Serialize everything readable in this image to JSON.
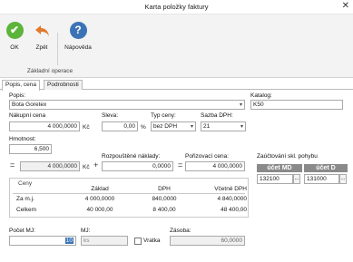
{
  "window": {
    "title": "Karta položky faktury",
    "close_glyph": "✕"
  },
  "ribbon": {
    "ok_label": "OK",
    "back_label": "Zpět",
    "help_label": "Nápověda",
    "group_label": "Základní operace",
    "ok_icon": "check-circle-icon",
    "back_icon": "undo-arrow-icon",
    "help_icon": "question-circle-icon"
  },
  "tabs": [
    {
      "label": "Popis, cena",
      "active": true
    },
    {
      "label": "Podrobnosti",
      "active": false
    }
  ],
  "form": {
    "popis_label": "Popis:",
    "popis_value": "Bota Goretex",
    "katalog_label": "Katalog:",
    "katalog_value": "K50",
    "nakupni_label": "Nákupní cena",
    "nakupni_value": "4 000,0000",
    "nakupni_unit": "Kč",
    "sleva_label": "Sleva:",
    "sleva_value": "0,00",
    "sleva_unit": "%",
    "typ_label": "Typ ceny:",
    "typ_value": "bez DPH",
    "sazba_label": "Sazba DPH:",
    "sazba_value": "21",
    "hmotnost_label": "Hmotnost:",
    "hmotnost_value": "6,500",
    "eq1": "=",
    "cena_value": "4 000,0000",
    "cena_unit": "Kč",
    "plus": "+",
    "rozp_label": "Rozpouštěné náklady:",
    "rozp_value": "0,0000",
    "eq2": "=",
    "poriz_label": "Pořizovací cena:",
    "poriz_value": "4 000,0000"
  },
  "prices": {
    "group_label": "Ceny",
    "columns": [
      "Základ",
      "DPH",
      "Včetně DPH"
    ],
    "rows": [
      {
        "label": "Za m.j.",
        "zaklad": "4 000,0000",
        "dph": "840,0000",
        "vcetne": "4 840,0000"
      },
      {
        "label": "Celkem",
        "zaklad": "40 000,00",
        "dph": "8 400,00",
        "vcetne": "48 400,00"
      }
    ]
  },
  "zauctovani": {
    "label": "Zaúčtování skl. pohybu",
    "md_header": "účet MD",
    "d_header": "účet D",
    "md_value": "132100",
    "d_value": "131000",
    "dots": "..."
  },
  "bottom": {
    "pocet_label": "Počet MJ:",
    "pocet_value": "10",
    "mj_label": "MJ:",
    "mj_value": "ks",
    "vratka_label": "Vratka",
    "zasoba_label": "Zásoba:",
    "zasoba_value": "60,0000"
  },
  "colors": {
    "accent_green": "#5cb43a",
    "accent_blue": "#3c73b6",
    "header_gray": "#8a8a8a"
  }
}
